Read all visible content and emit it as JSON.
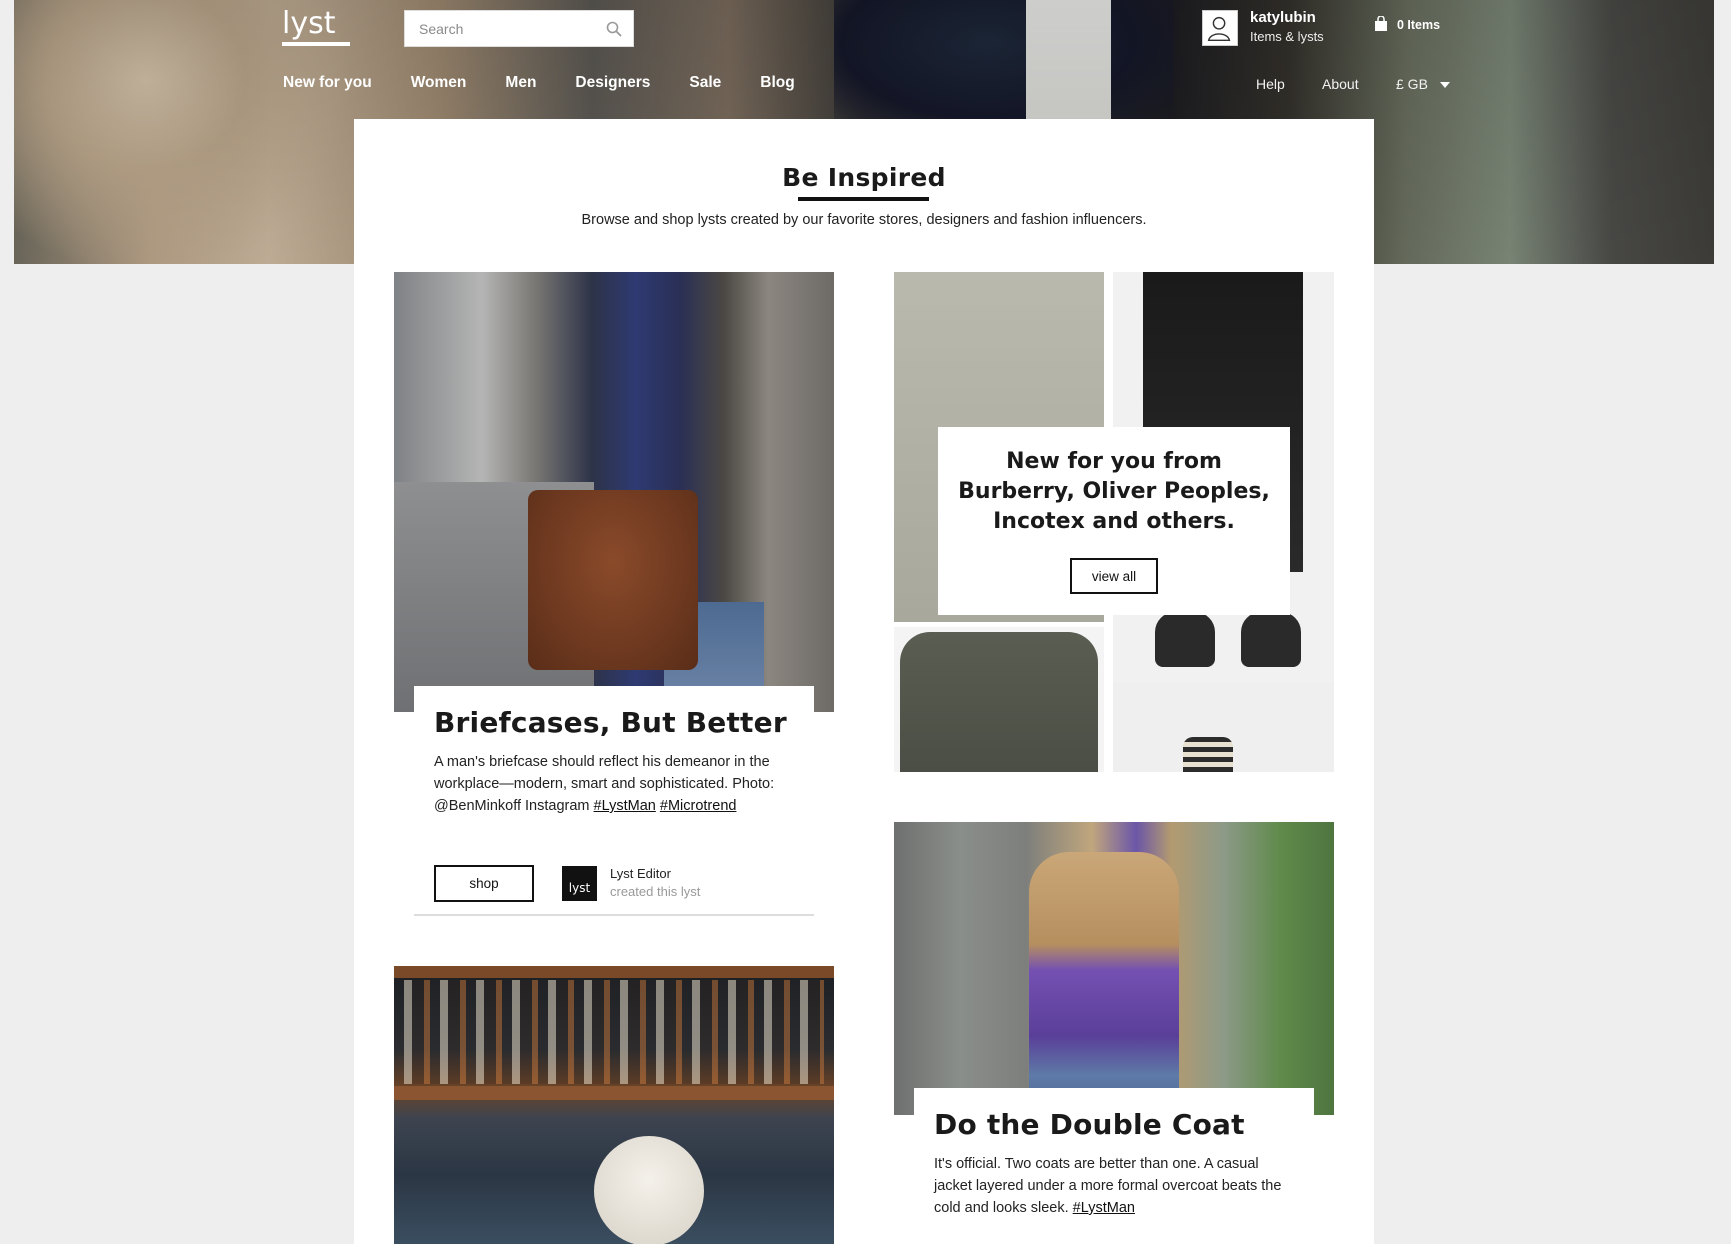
{
  "header": {
    "logo": "lyst",
    "search_placeholder": "Search",
    "nav": [
      "New for you",
      "Women",
      "Men",
      "Designers",
      "Sale",
      "Blog"
    ],
    "help": "Help",
    "about": "About",
    "currency": "£ GB",
    "user_name": "katylubin",
    "user_sub": "Items & lysts",
    "bag_count": "0 Items"
  },
  "intro": {
    "title": "Be Inspired",
    "subtitle": "Browse and shop lysts created by our favorite stores, designers and fashion influencers."
  },
  "lyst_briefcase": {
    "title": "Briefcases, But Better",
    "desc": "A man's briefcase should reflect his demeanor in the workplace—modern, smart and sophisticated. Photo: @BenMinkoff Instagram",
    "tag1": "#LystMan",
    "tag2": "#Microtrend",
    "shop_label": "shop",
    "editor_logo": "lyst",
    "editor_name": "Lyst Editor",
    "editor_sub": "created this lyst"
  },
  "lyst_new": {
    "title": "New for you from Burberry, Oliver Peoples, Incotex and others.",
    "button": "view all"
  },
  "lyst_coat": {
    "title": "Do the Double Coat",
    "desc": "It's official. Two coats are better than one. A casual jacket layered under a more formal overcoat beats the cold and looks sleek.",
    "tag": "#LystMan"
  }
}
